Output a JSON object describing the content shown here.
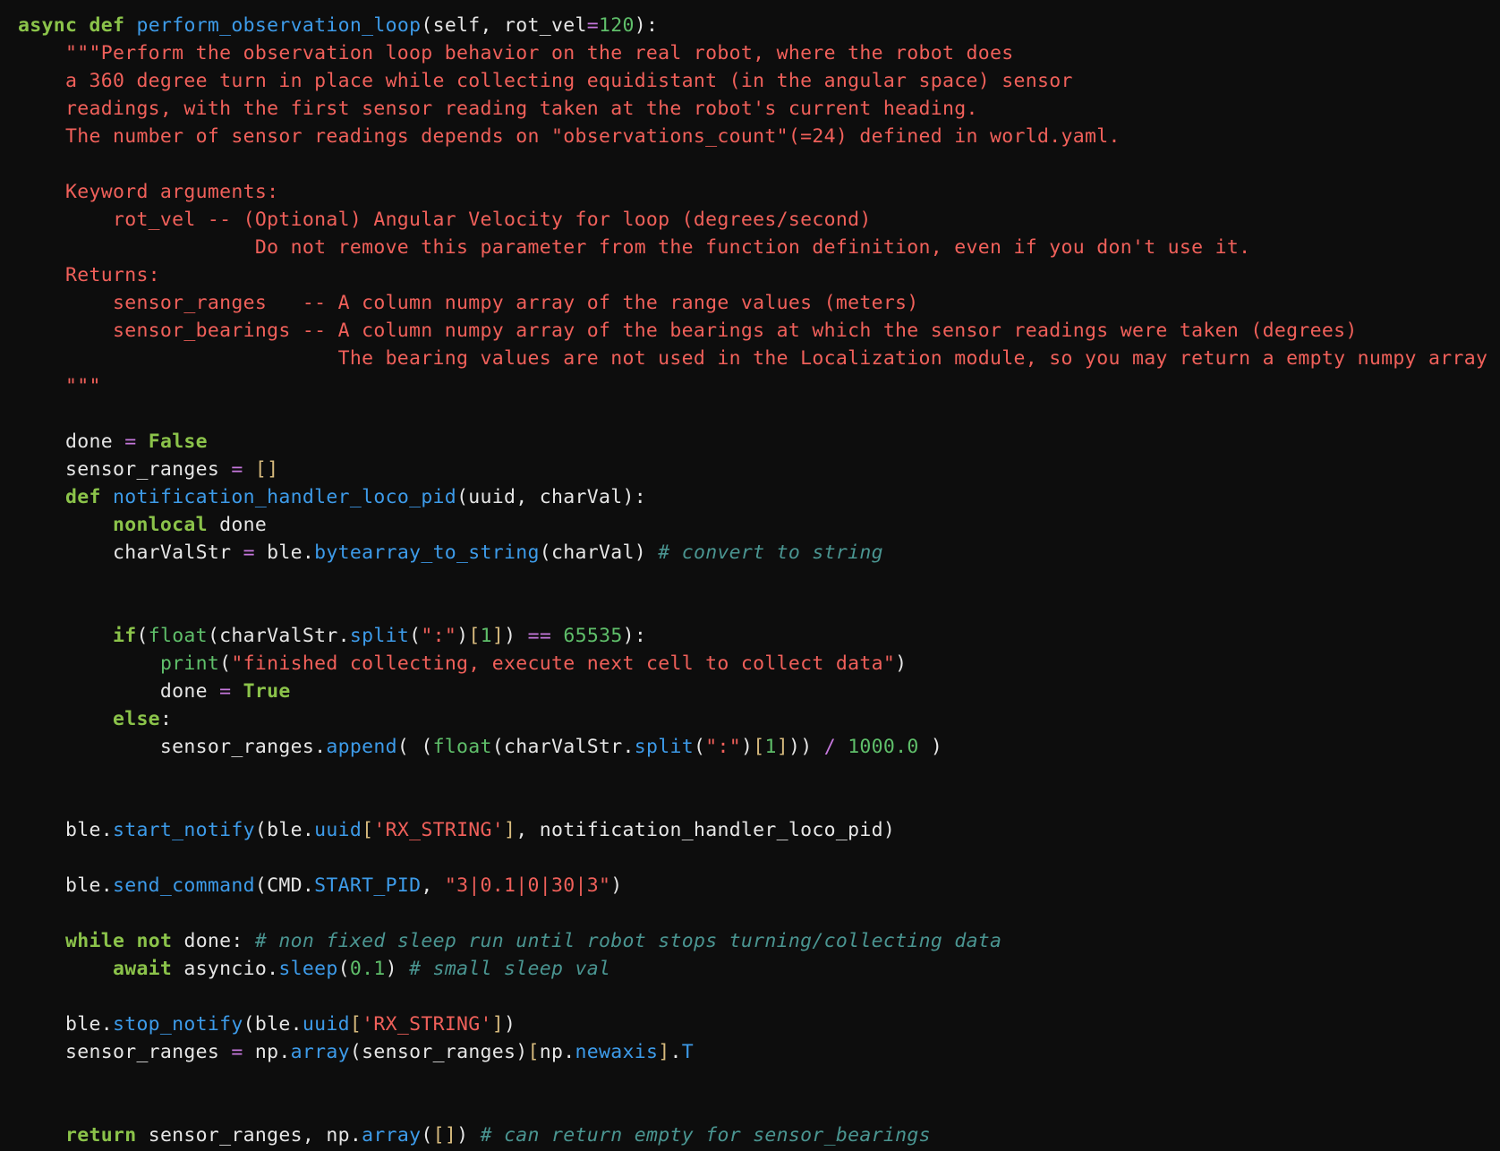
{
  "colors": {
    "background": "#0d0d0d",
    "text": "#e6e6e6",
    "keyword": "#8bc34a",
    "function": "#3d9be9",
    "string": "#f0605a",
    "number": "#5fbf6a",
    "operator": "#c678dd",
    "comment": "#4a9591",
    "bracket": "#d7ba7d"
  },
  "code_lines": [
    [
      [
        "kw",
        "async"
      ],
      [
        "t",
        " "
      ],
      [
        "kw",
        "def"
      ],
      [
        "t",
        " "
      ],
      [
        "fn",
        "perform_observation_loop"
      ],
      [
        "t",
        "(self, rot_vel"
      ],
      [
        "op",
        "="
      ],
      [
        "num",
        "120"
      ],
      [
        "t",
        "):"
      ]
    ],
    [
      [
        "str",
        "    \"\"\"Perform the observation loop behavior on the real robot, where the robot does"
      ]
    ],
    [
      [
        "str",
        "    a 360 degree turn in place while collecting equidistant (in the angular space) sensor"
      ]
    ],
    [
      [
        "str",
        "    readings, with the first sensor reading taken at the robot's current heading."
      ]
    ],
    [
      [
        "str",
        "    The number of sensor readings depends on \"observations_count\"(=24) defined in world.yaml."
      ]
    ],
    [],
    [
      [
        "str",
        "    Keyword arguments:"
      ]
    ],
    [
      [
        "str",
        "        rot_vel -- (Optional) Angular Velocity for loop (degrees/second)"
      ]
    ],
    [
      [
        "str",
        "                    Do not remove this parameter from the function definition, even if you don't use it."
      ]
    ],
    [
      [
        "str",
        "    Returns:"
      ]
    ],
    [
      [
        "str",
        "        sensor_ranges   -- A column numpy array of the range values (meters)"
      ]
    ],
    [
      [
        "str",
        "        sensor_bearings -- A column numpy array of the bearings at which the sensor readings were taken (degrees)"
      ]
    ],
    [
      [
        "str",
        "                           The bearing values are not used in the Localization module, so you may return a empty numpy array"
      ]
    ],
    [
      [
        "str",
        "    \"\"\""
      ]
    ],
    [],
    [
      [
        "t",
        "    done "
      ],
      [
        "op",
        "="
      ],
      [
        "t",
        " "
      ],
      [
        "kw",
        "False"
      ]
    ],
    [
      [
        "t",
        "    sensor_ranges "
      ],
      [
        "op",
        "="
      ],
      [
        "t",
        " "
      ],
      [
        "br",
        "[]"
      ]
    ],
    [
      [
        "t",
        "    "
      ],
      [
        "kw",
        "def"
      ],
      [
        "t",
        " "
      ],
      [
        "fn",
        "notification_handler_loco_pid"
      ],
      [
        "t",
        "(uuid, charVal):"
      ]
    ],
    [
      [
        "t",
        "        "
      ],
      [
        "kw",
        "nonlocal"
      ],
      [
        "t",
        " done"
      ]
    ],
    [
      [
        "t",
        "        charValStr "
      ],
      [
        "op",
        "="
      ],
      [
        "t",
        " ble."
      ],
      [
        "fn",
        "bytearray_to_string"
      ],
      [
        "t",
        "(charVal) "
      ],
      [
        "cm",
        "# convert to string"
      ]
    ],
    [],
    [],
    [
      [
        "t",
        "        "
      ],
      [
        "kw",
        "if"
      ],
      [
        "t",
        "("
      ],
      [
        "num",
        "float"
      ],
      [
        "t",
        "(charValStr."
      ],
      [
        "fn",
        "split"
      ],
      [
        "t",
        "("
      ],
      [
        "str",
        "\":\""
      ],
      [
        "t",
        ")"
      ],
      [
        "br",
        "["
      ],
      [
        "num",
        "1"
      ],
      [
        "br",
        "]"
      ],
      [
        "t",
        ") "
      ],
      [
        "op",
        "=="
      ],
      [
        "t",
        " "
      ],
      [
        "num",
        "65535"
      ],
      [
        "t",
        "):"
      ]
    ],
    [
      [
        "t",
        "            "
      ],
      [
        "num",
        "print"
      ],
      [
        "t",
        "("
      ],
      [
        "str",
        "\"finished collecting, execute next cell to collect data\""
      ],
      [
        "t",
        ")"
      ]
    ],
    [
      [
        "t",
        "            done "
      ],
      [
        "op",
        "="
      ],
      [
        "t",
        " "
      ],
      [
        "kw",
        "True"
      ]
    ],
    [
      [
        "t",
        "        "
      ],
      [
        "kw",
        "else"
      ],
      [
        "t",
        ":"
      ]
    ],
    [
      [
        "t",
        "            sensor_ranges."
      ],
      [
        "fn",
        "append"
      ],
      [
        "t",
        "( ("
      ],
      [
        "num",
        "float"
      ],
      [
        "t",
        "(charValStr."
      ],
      [
        "fn",
        "split"
      ],
      [
        "t",
        "("
      ],
      [
        "str",
        "\":\""
      ],
      [
        "t",
        ")"
      ],
      [
        "br",
        "["
      ],
      [
        "num",
        "1"
      ],
      [
        "br",
        "]"
      ],
      [
        "t",
        ")) "
      ],
      [
        "op",
        "/"
      ],
      [
        "t",
        " "
      ],
      [
        "num",
        "1000.0"
      ],
      [
        "t",
        " )"
      ]
    ],
    [],
    [],
    [
      [
        "t",
        "    ble."
      ],
      [
        "fn",
        "start_notify"
      ],
      [
        "t",
        "(ble."
      ],
      [
        "fn",
        "uuid"
      ],
      [
        "br",
        "["
      ],
      [
        "str",
        "'RX_STRING'"
      ],
      [
        "br",
        "]"
      ],
      [
        "t",
        ", notification_handler_loco_pid)"
      ]
    ],
    [],
    [
      [
        "t",
        "    ble."
      ],
      [
        "fn",
        "send_command"
      ],
      [
        "t",
        "(CMD."
      ],
      [
        "fn",
        "START_PID"
      ],
      [
        "t",
        ", "
      ],
      [
        "str",
        "\"3|0.1|0|30|3\""
      ],
      [
        "t",
        ")"
      ]
    ],
    [],
    [
      [
        "t",
        "    "
      ],
      [
        "kw",
        "while"
      ],
      [
        "t",
        " "
      ],
      [
        "kw",
        "not"
      ],
      [
        "t",
        " done: "
      ],
      [
        "cm",
        "# non fixed sleep run until robot stops turning/collecting data"
      ]
    ],
    [
      [
        "t",
        "        "
      ],
      [
        "kw",
        "await"
      ],
      [
        "t",
        " asyncio."
      ],
      [
        "fn",
        "sleep"
      ],
      [
        "t",
        "("
      ],
      [
        "num",
        "0.1"
      ],
      [
        "t",
        ") "
      ],
      [
        "cm",
        "# small sleep val"
      ]
    ],
    [],
    [
      [
        "t",
        "    ble."
      ],
      [
        "fn",
        "stop_notify"
      ],
      [
        "t",
        "(ble."
      ],
      [
        "fn",
        "uuid"
      ],
      [
        "br",
        "["
      ],
      [
        "str",
        "'RX_STRING'"
      ],
      [
        "br",
        "]"
      ],
      [
        "t",
        ")"
      ]
    ],
    [
      [
        "t",
        "    sensor_ranges "
      ],
      [
        "op",
        "="
      ],
      [
        "t",
        " np."
      ],
      [
        "fn",
        "array"
      ],
      [
        "t",
        "(sensor_ranges)"
      ],
      [
        "br",
        "["
      ],
      [
        "t",
        "np."
      ],
      [
        "fn",
        "newaxis"
      ],
      [
        "br",
        "]"
      ],
      [
        "t",
        "."
      ],
      [
        "fn",
        "T"
      ]
    ],
    [],
    [],
    [
      [
        "t",
        "    "
      ],
      [
        "kw",
        "return"
      ],
      [
        "t",
        " sensor_ranges, np."
      ],
      [
        "fn",
        "array"
      ],
      [
        "t",
        "("
      ],
      [
        "br",
        "[]"
      ],
      [
        "t",
        ") "
      ],
      [
        "cm",
        "# can return empty for sensor_bearings"
      ]
    ]
  ]
}
